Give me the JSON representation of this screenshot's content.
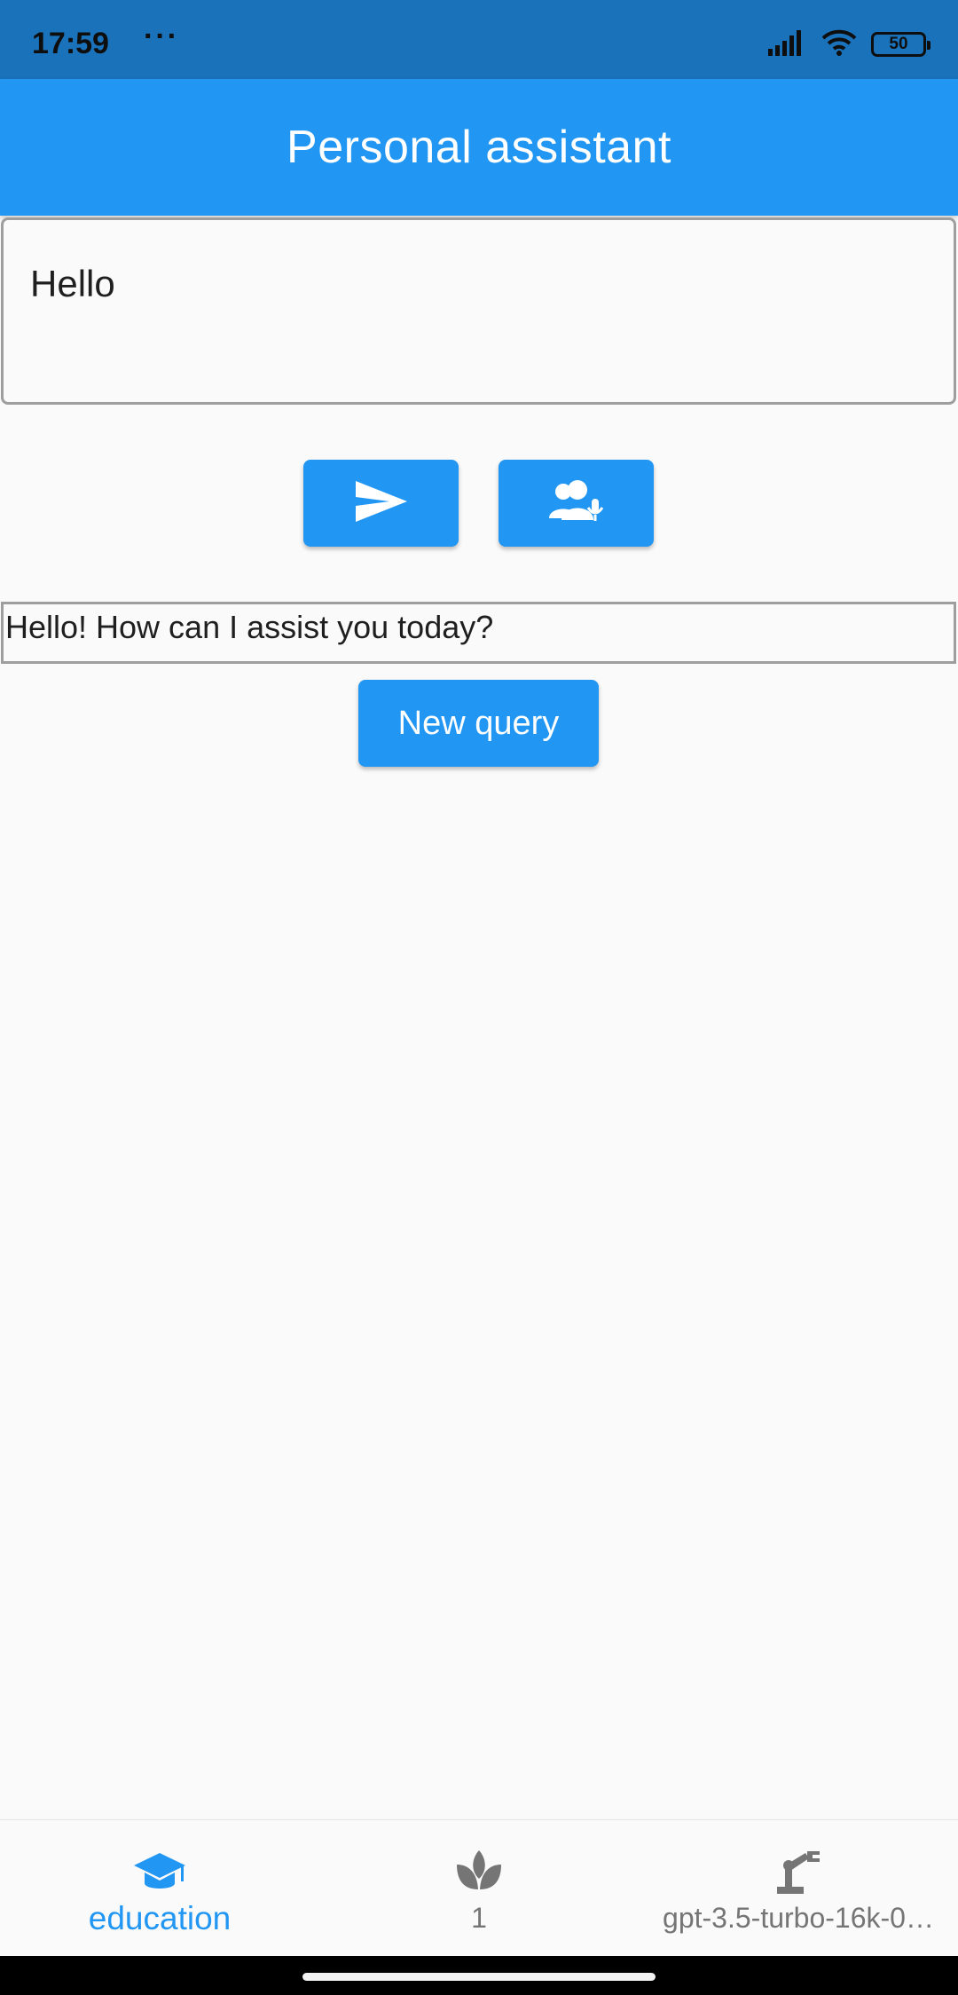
{
  "status_bar": {
    "time": "17:59",
    "dots": "···",
    "battery": "50",
    "icons": [
      "signal-icon",
      "wifi-icon",
      "battery-icon"
    ]
  },
  "app_bar": {
    "title": "Personal assistant"
  },
  "query": {
    "value": "Hello"
  },
  "actions": {
    "send_icon": "send-icon",
    "voice_icon": "voice-user-mic-icon"
  },
  "response": {
    "text": "Hello! How can I assist you today?"
  },
  "new_query": {
    "label": "New query"
  },
  "bottom_nav": {
    "items": [
      {
        "label": "education",
        "icon": "graduation-cap-icon",
        "active": true
      },
      {
        "label": "1",
        "icon": "lotus-icon",
        "active": false
      },
      {
        "label": "gpt-3.5-turbo-16k-0…",
        "icon": "robot-arm-icon",
        "active": false
      }
    ]
  },
  "colors": {
    "primary": "#2196f3",
    "status_bar": "#1a72bb",
    "background": "#fafafa",
    "inactive": "#757575"
  }
}
